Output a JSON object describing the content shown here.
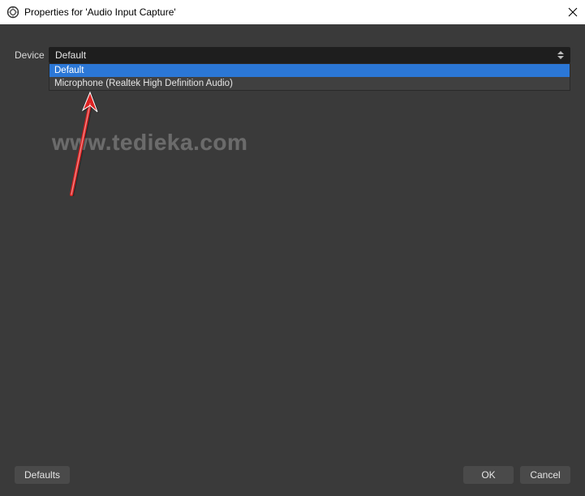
{
  "window": {
    "title": "Properties for 'Audio Input Capture'"
  },
  "form": {
    "device_label": "Device",
    "selected": "Default",
    "options": {
      "0": "Default",
      "1": "Microphone (Realtek High Definition Audio)"
    }
  },
  "watermark": {
    "text": "www.tedieka.com"
  },
  "buttons": {
    "defaults": "Defaults",
    "ok": "OK",
    "cancel": "Cancel"
  }
}
